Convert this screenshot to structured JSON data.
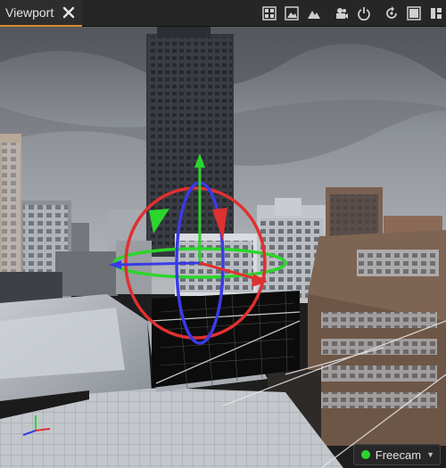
{
  "tab": {
    "label": "Viewport"
  },
  "toolbar": {
    "buttons": [
      {
        "icon": "grid-layout-icon"
      },
      {
        "icon": "image-icon"
      },
      {
        "icon": "terrain-icon"
      },
      {
        "icon": "camera-icon"
      },
      {
        "icon": "power-icon"
      },
      {
        "icon": "rotate-snap-icon"
      },
      {
        "icon": "maximize-icon"
      },
      {
        "icon": "panel-split-icon"
      }
    ]
  },
  "camera_mode": {
    "label": "Freecam",
    "status_color": "#2bd62b"
  },
  "colors": {
    "accent": "#d78a2a",
    "gizmo_x": "#e03030",
    "gizmo_y": "#2bd62b",
    "gizmo_z": "#3a3ae8"
  }
}
